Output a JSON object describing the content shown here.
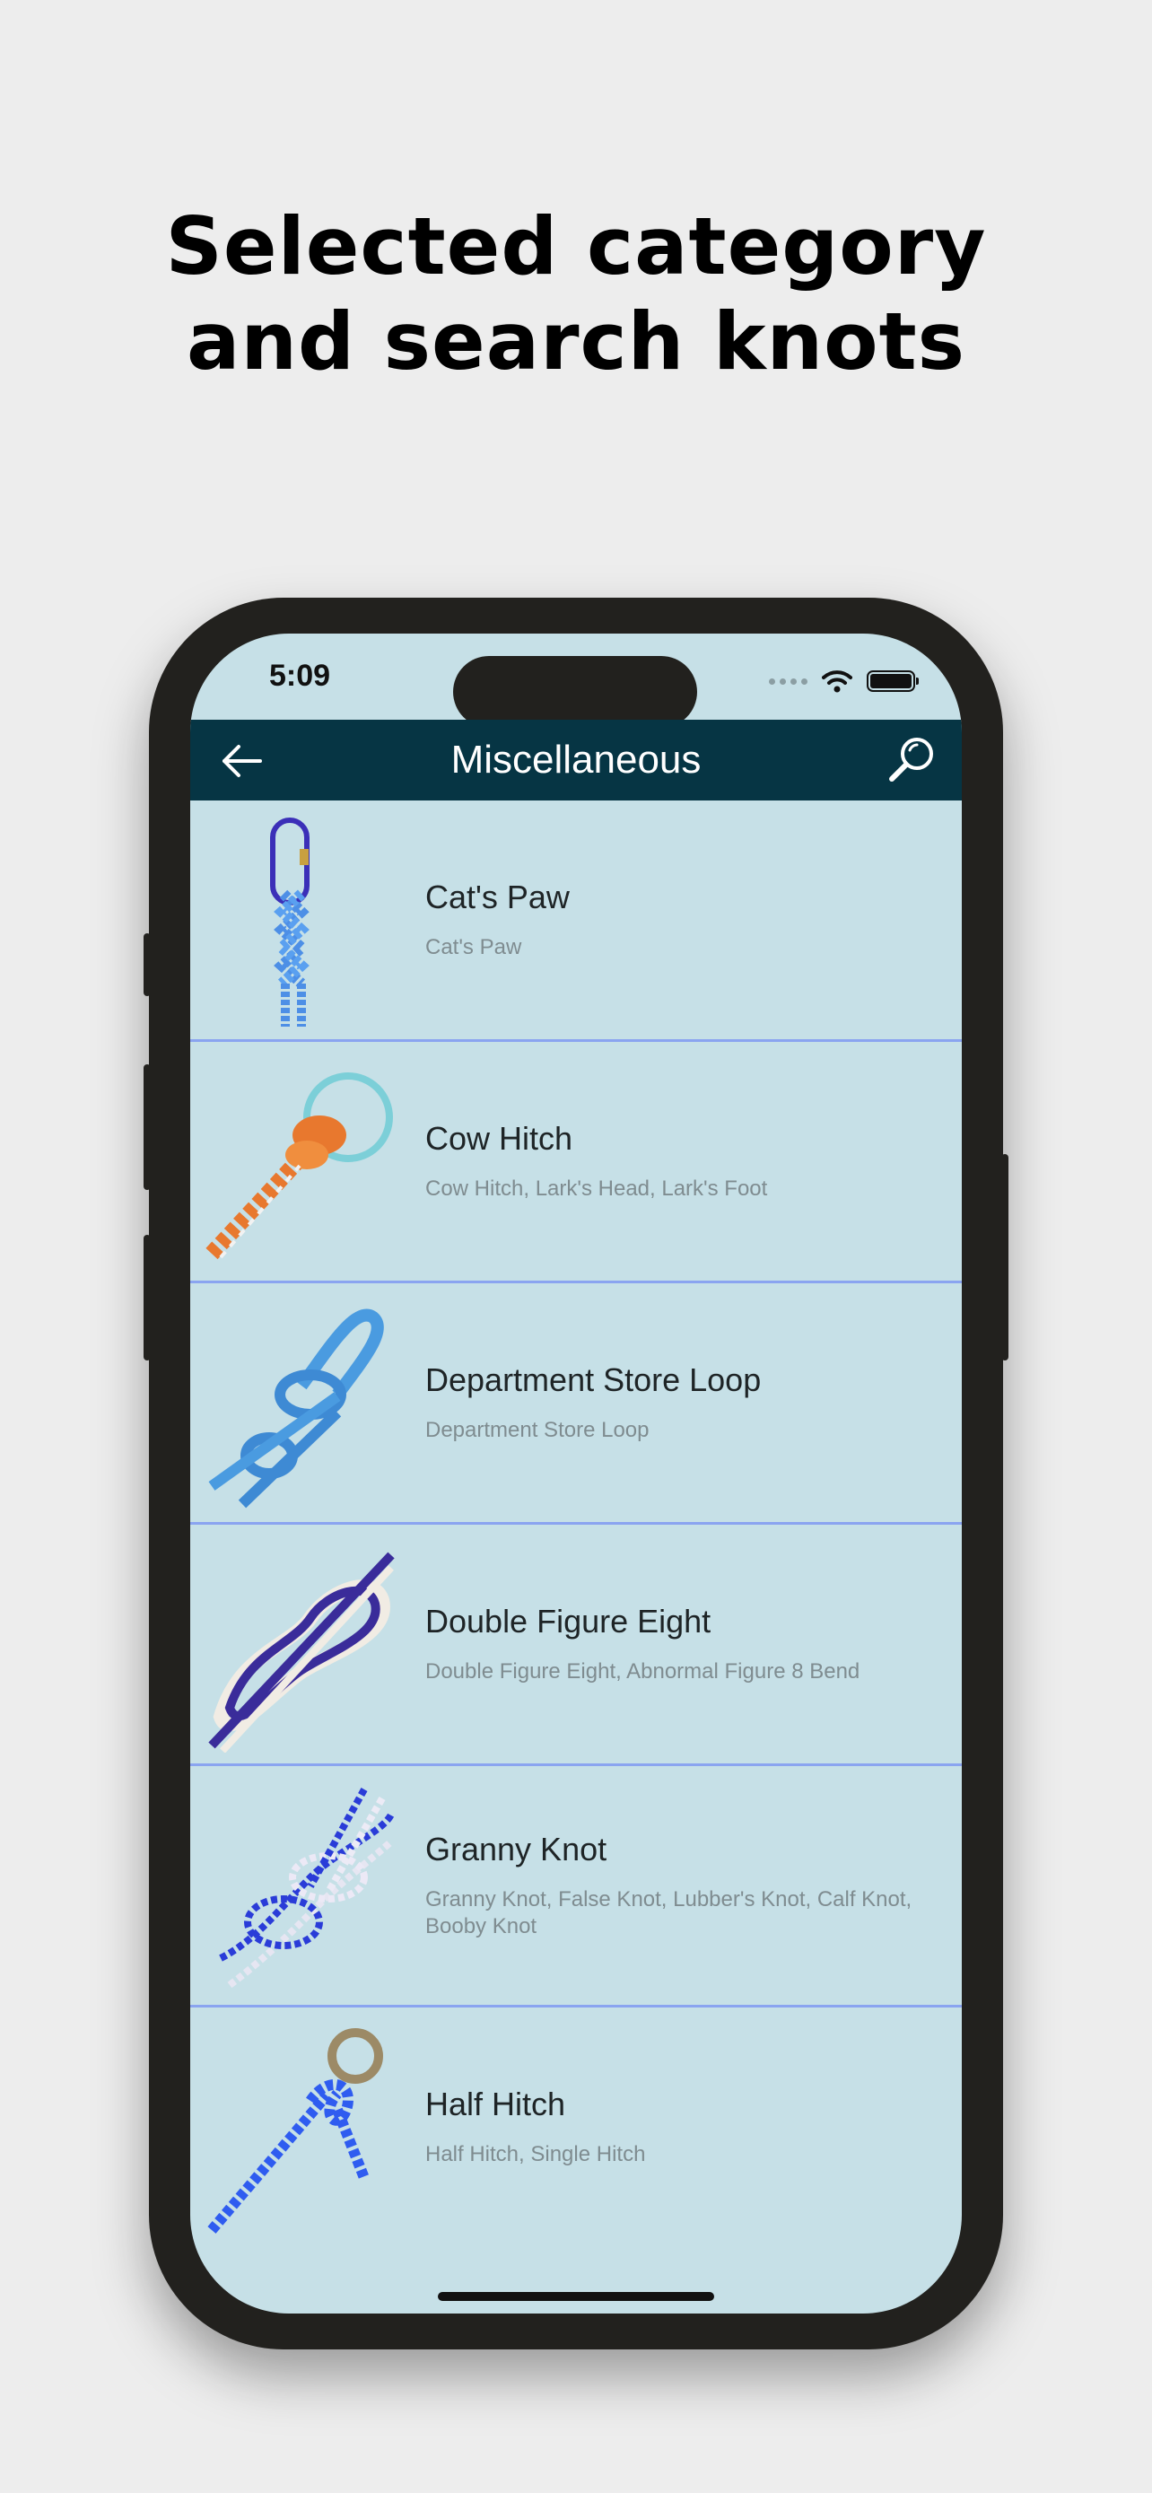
{
  "headline": {
    "line1": "Selected category",
    "line2": "and search knots"
  },
  "status_bar": {
    "time": "5:09"
  },
  "navbar": {
    "title": "Miscellaneous",
    "back_icon": "arrow-left-icon",
    "search_icon": "magnifier-icon"
  },
  "knots": [
    {
      "title": "Cat's Paw",
      "subtitle": "Cat's Paw",
      "image": "cats-paw-knot"
    },
    {
      "title": "Cow Hitch",
      "subtitle": "Cow Hitch, Lark's Head, Lark's Foot",
      "image": "cow-hitch-knot"
    },
    {
      "title": "Department Store Loop",
      "subtitle": "Department Store Loop",
      "image": "department-store-loop-knot"
    },
    {
      "title": "Double Figure Eight",
      "subtitle": "Double Figure Eight, Abnormal Figure 8 Bend",
      "image": "double-figure-eight-knot"
    },
    {
      "title": "Granny Knot",
      "subtitle": "Granny Knot, False Knot, Lubber's Knot, Calf Knot, Booby Knot",
      "image": "granny-knot"
    },
    {
      "title": "Half Hitch",
      "subtitle": "Half Hitch, Single Hitch",
      "image": "half-hitch-knot"
    }
  ],
  "colors": {
    "background": "#ededed",
    "screen": "#c6e0e7",
    "navbar": "#063544",
    "divider": "#8aa4f0",
    "phone_frame": "#22211e"
  }
}
